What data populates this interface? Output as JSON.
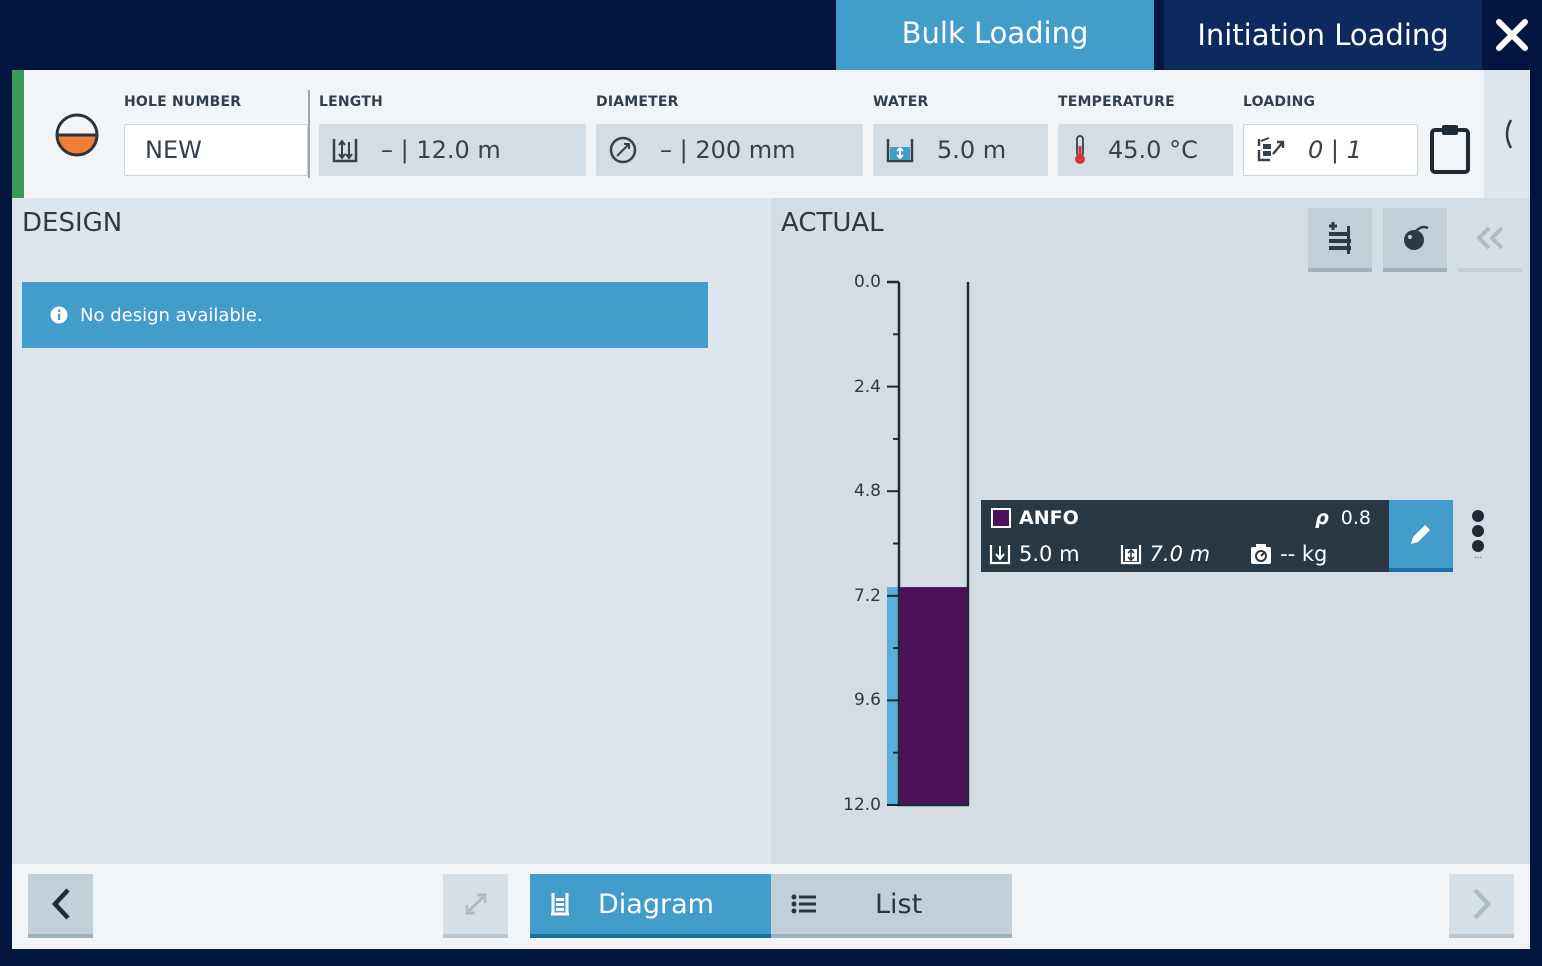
{
  "tabs": {
    "bulk": "Bulk Loading",
    "initiation": "Initiation Loading"
  },
  "header": {
    "hole_number": {
      "label": "HOLE NUMBER",
      "value": "NEW"
    },
    "length": {
      "label": "LENGTH",
      "value": "–  |  12.0  m"
    },
    "diameter": {
      "label": "DIAMETER",
      "value": "– | 200  mm"
    },
    "water": {
      "label": "WATER",
      "value": "5.0  m"
    },
    "temperature": {
      "label": "TEMPERATURE",
      "value": "45.0  °C"
    },
    "loading": {
      "label": "LOADING",
      "value": "0 | 1"
    }
  },
  "design": {
    "title": "DESIGN",
    "notice": "No design available."
  },
  "actual": {
    "title": "ACTUAL",
    "depth_ticks": [
      "0.0",
      "2.4",
      "4.8",
      "7.2",
      "9.6",
      "12.0"
    ],
    "depth_max": 12.0,
    "water_depth": 5.0,
    "deck": {
      "name": "ANFO",
      "density_label": "ρ",
      "density": "0.8",
      "length": "5.0 m",
      "top_depth": "7.0 m",
      "mass": "-- kg",
      "color": "#4c1258",
      "from_depth": 7.0,
      "to_depth": 12.0
    },
    "kebab_hint": "..."
  },
  "footer": {
    "diagram": "Diagram",
    "list": "List"
  },
  "colors": {
    "accent": "#429dcb",
    "navy": "#021640",
    "water": "#5aaedb",
    "anfo": "#4c1258",
    "orange": "#f07f33"
  }
}
